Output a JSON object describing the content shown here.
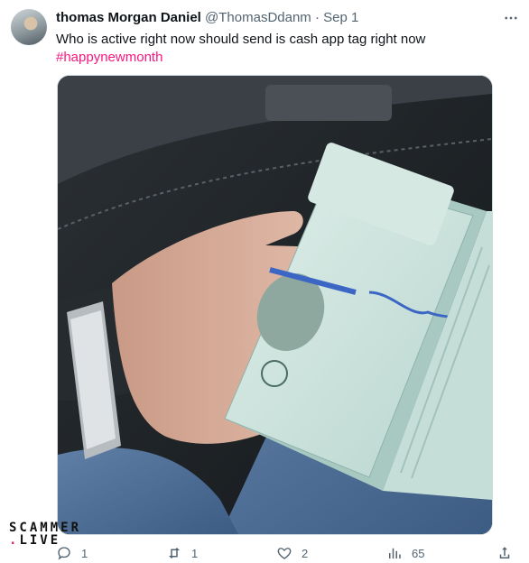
{
  "author": {
    "name": "thomas Morgan Daniel",
    "handle": "@ThomasDdanm",
    "separator": "·",
    "date": "Sep 1"
  },
  "tweet": {
    "text": "Who is active right now should send is cash app tag right now",
    "hashtag": "#happynewmonth"
  },
  "media": {
    "alt": "photo of a hand holding a thick stack of 100 dollar bills inside a car"
  },
  "actions": {
    "reply_count": "1",
    "retweet_count": "1",
    "like_count": "2",
    "views_count": "65"
  },
  "watermark": {
    "line1": "SCAMMER",
    "line2_dot": ".",
    "line2": "LIVE"
  },
  "colors": {
    "hashtag": "#f91880",
    "secondary_text": "#536471",
    "border": "#cfd9de"
  }
}
